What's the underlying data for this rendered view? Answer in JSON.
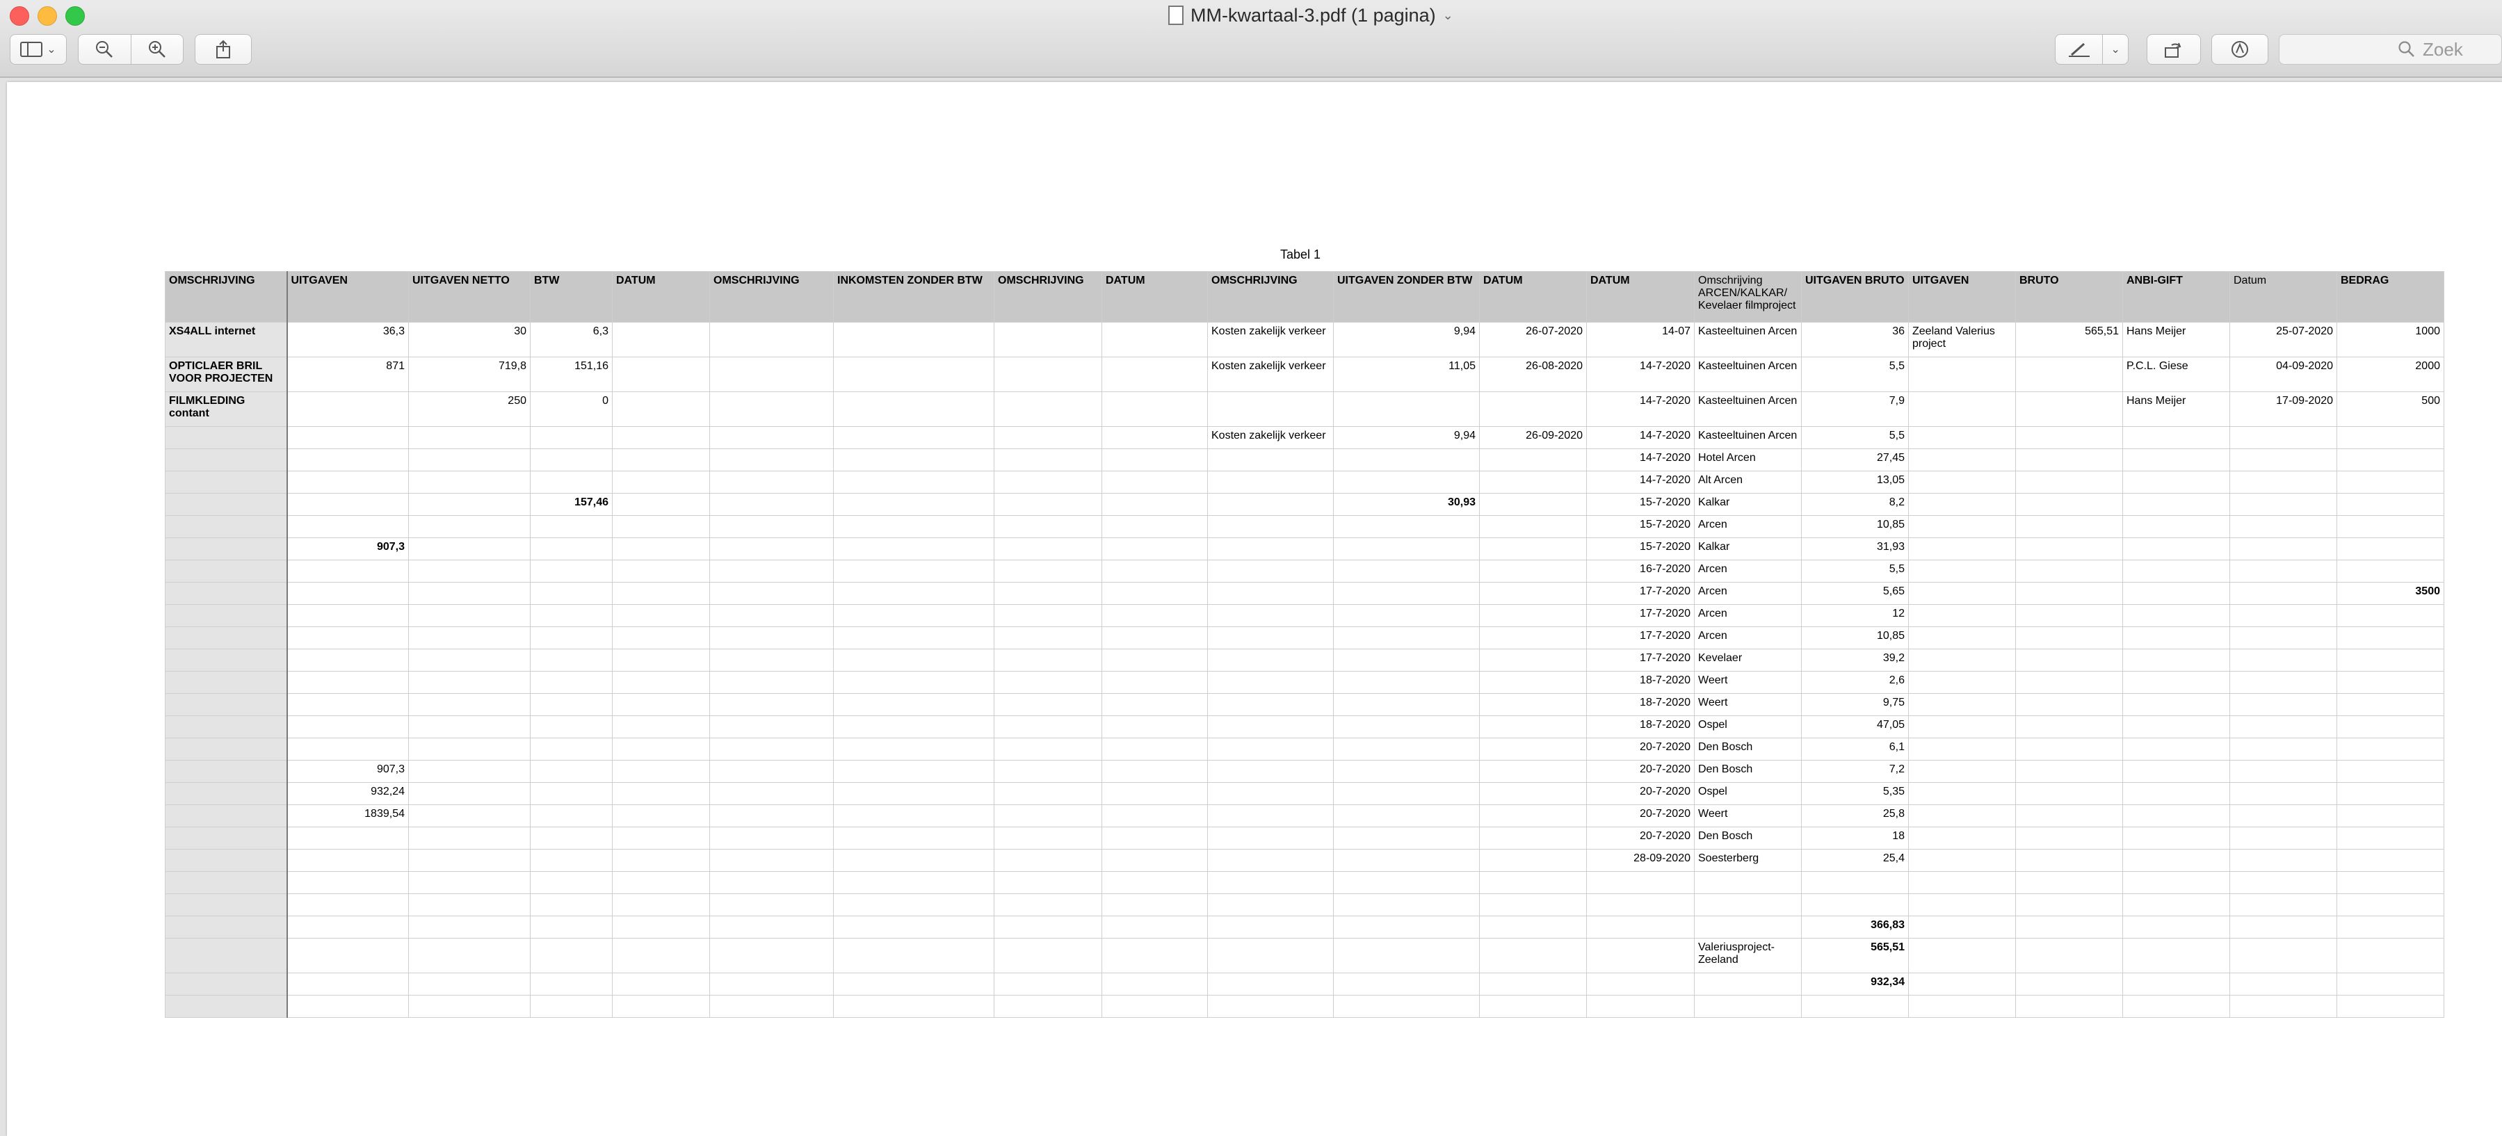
{
  "window": {
    "title": "MM-kwartaal-3.pdf (1 pagina)"
  },
  "toolbar": {
    "search_placeholder": "Zoek"
  },
  "caption": "Tabel 1",
  "table": {
    "headers": [
      "OMSCHRIJVING",
      "UITGAVEN",
      "UITGAVEN NETTO",
      "BTW",
      "DATUM",
      "OMSCHRIJVING",
      "INKOMSTEN ZONDER BTW",
      "OMSCHRIJVING",
      "DATUM",
      "OMSCHRIJVING",
      "UITGAVEN ZONDER BTW",
      "DATUM",
      "DATUM",
      "Omschrijving ARCEN/KALKAR/ Kevelaer filmproject",
      "UITGAVEN BRUTO",
      "UITGAVEN",
      "BRUTO",
      "ANBI-GIFT",
      "Datum",
      "BEDRAG"
    ],
    "rows": [
      [
        "XS4ALL internet",
        "36,3",
        "30",
        "6,3",
        "",
        "",
        "",
        "",
        "",
        "Kosten zakelijk verkeer",
        "9,94",
        "26-07-2020",
        "14-07",
        "Kasteeltuinen Arcen",
        "36",
        "Zeeland Valerius project",
        "565,51",
        "Hans Meijer",
        "25-07-2020",
        "1000"
      ],
      [
        "OPTICLAER BRIL VOOR PROJECTEN",
        "871",
        "719,8",
        "151,16",
        "",
        "",
        "",
        "",
        "",
        "Kosten zakelijk verkeer",
        "11,05",
        "26-08-2020",
        "14-7-2020",
        "Kasteeltuinen Arcen",
        "5,5",
        "",
        "",
        "P.C.L. Giese",
        "04-09-2020",
        "2000"
      ],
      [
        "FILMKLEDING contant",
        "",
        "250",
        "0",
        "",
        "",
        "",
        "",
        "",
        "",
        "",
        "",
        "14-7-2020",
        "Kasteeltuinen Arcen",
        "7,9",
        "",
        "",
        "Hans Meijer",
        "17-09-2020",
        "500"
      ],
      [
        "",
        "",
        "",
        "",
        "",
        "",
        "",
        "",
        "",
        "Kosten zakelijk verkeer",
        "9,94",
        "26-09-2020",
        "14-7-2020",
        "Kasteeltuinen Arcen",
        "5,5",
        "",
        "",
        "",
        "",
        ""
      ],
      [
        "",
        "",
        "",
        "",
        "",
        "",
        "",
        "",
        "",
        "",
        "",
        "",
        "14-7-2020",
        "Hotel Arcen",
        "27,45",
        "",
        "",
        "",
        "",
        ""
      ],
      [
        "",
        "",
        "",
        "",
        "",
        "",
        "",
        "",
        "",
        "",
        "",
        "",
        "14-7-2020",
        "Alt Arcen",
        "13,05",
        "",
        "",
        "",
        "",
        ""
      ],
      [
        "",
        "",
        "",
        "157,46",
        "",
        "",
        "",
        "",
        "",
        "",
        "30,93",
        "",
        "15-7-2020",
        "Kalkar",
        "8,2",
        "",
        "",
        "",
        "",
        ""
      ],
      [
        "",
        "",
        "",
        "",
        "",
        "",
        "",
        "",
        "",
        "",
        "",
        "",
        "15-7-2020",
        "Arcen",
        "10,85",
        "",
        "",
        "",
        "",
        ""
      ],
      [
        "",
        "907,3",
        "",
        "",
        "",
        "",
        "",
        "",
        "",
        "",
        "",
        "",
        "15-7-2020",
        "Kalkar",
        "31,93",
        "",
        "",
        "",
        "",
        ""
      ],
      [
        "",
        "",
        "",
        "",
        "",
        "",
        "",
        "",
        "",
        "",
        "",
        "",
        "16-7-2020",
        "Arcen",
        "5,5",
        "",
        "",
        "",
        "",
        ""
      ],
      [
        "",
        "",
        "",
        "",
        "",
        "",
        "",
        "",
        "",
        "",
        "",
        "",
        "17-7-2020",
        "Arcen",
        "5,65",
        "",
        "",
        "",
        "",
        "3500"
      ],
      [
        "",
        "",
        "",
        "",
        "",
        "",
        "",
        "",
        "",
        "",
        "",
        "",
        "17-7-2020",
        "Arcen",
        "12",
        "",
        "",
        "",
        "",
        ""
      ],
      [
        "",
        "",
        "",
        "",
        "",
        "",
        "",
        "",
        "",
        "",
        "",
        "",
        "17-7-2020",
        "Arcen",
        "10,85",
        "",
        "",
        "",
        "",
        ""
      ],
      [
        "",
        "",
        "",
        "",
        "",
        "",
        "",
        "",
        "",
        "",
        "",
        "",
        "17-7-2020",
        "Kevelaer",
        "39,2",
        "",
        "",
        "",
        "",
        ""
      ],
      [
        "",
        "",
        "",
        "",
        "",
        "",
        "",
        "",
        "",
        "",
        "",
        "",
        "18-7-2020",
        "Weert",
        "2,6",
        "",
        "",
        "",
        "",
        ""
      ],
      [
        "",
        "",
        "",
        "",
        "",
        "",
        "",
        "",
        "",
        "",
        "",
        "",
        "18-7-2020",
        "Weert",
        "9,75",
        "",
        "",
        "",
        "",
        ""
      ],
      [
        "",
        "",
        "",
        "",
        "",
        "",
        "",
        "",
        "",
        "",
        "",
        "",
        "18-7-2020",
        "Ospel",
        "47,05",
        "",
        "",
        "",
        "",
        ""
      ],
      [
        "",
        "",
        "",
        "",
        "",
        "",
        "",
        "",
        "",
        "",
        "",
        "",
        "20-7-2020",
        "Den Bosch",
        "6,1",
        "",
        "",
        "",
        "",
        ""
      ],
      [
        "",
        "907,3",
        "",
        "",
        "",
        "",
        "",
        "",
        "",
        "",
        "",
        "",
        "20-7-2020",
        "Den Bosch",
        "7,2",
        "",
        "",
        "",
        "",
        ""
      ],
      [
        "",
        "932,24",
        "",
        "",
        "",
        "",
        "",
        "",
        "",
        "",
        "",
        "",
        "20-7-2020",
        "Ospel",
        "5,35",
        "",
        "",
        "",
        "",
        ""
      ],
      [
        "",
        "1839,54",
        "",
        "",
        "",
        "",
        "",
        "",
        "",
        "",
        "",
        "",
        "20-7-2020",
        "Weert",
        "25,8",
        "",
        "",
        "",
        "",
        ""
      ],
      [
        "",
        "",
        "",
        "",
        "",
        "",
        "",
        "",
        "",
        "",
        "",
        "",
        "20-7-2020",
        "Den Bosch",
        "18",
        "",
        "",
        "",
        "",
        ""
      ],
      [
        "",
        "",
        "",
        "",
        "",
        "",
        "",
        "",
        "",
        "",
        "",
        "",
        "28-09-2020",
        "Soesterberg",
        "25,4",
        "",
        "",
        "",
        "",
        ""
      ],
      [
        "",
        "",
        "",
        "",
        "",
        "",
        "",
        "",
        "",
        "",
        "",
        "",
        "",
        "",
        "",
        "",
        "",
        "",
        "",
        ""
      ],
      [
        "",
        "",
        "",
        "",
        "",
        "",
        "",
        "",
        "",
        "",
        "",
        "",
        "",
        "",
        "",
        "",
        "",
        "",
        "",
        ""
      ],
      [
        "",
        "",
        "",
        "",
        "",
        "",
        "",
        "",
        "",
        "",
        "",
        "",
        "",
        "",
        "366,83",
        "",
        "",
        "",
        "",
        ""
      ],
      [
        "",
        "",
        "",
        "",
        "",
        "",
        "",
        "",
        "",
        "",
        "",
        "",
        "",
        "Valeriusproject-Zeeland",
        "565,51",
        "",
        "",
        "",
        "",
        ""
      ],
      [
        "",
        "",
        "",
        "",
        "",
        "",
        "",
        "",
        "",
        "",
        "",
        "",
        "",
        "",
        "932,34",
        "",
        "",
        "",
        "",
        ""
      ],
      [
        "",
        "",
        "",
        "",
        "",
        "",
        "",
        "",
        "",
        "",
        "",
        "",
        "",
        "",
        "",
        "",
        "",
        "",
        "",
        ""
      ]
    ]
  }
}
